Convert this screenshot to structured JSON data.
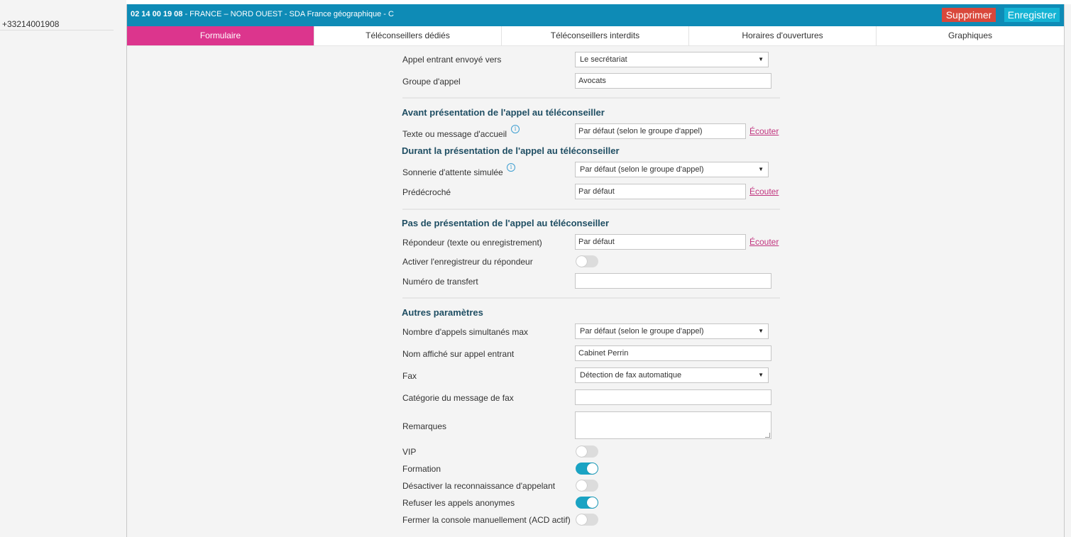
{
  "left_panel": {
    "phone": "+33214001908"
  },
  "header": {
    "number": "02 14 00 19 08",
    "description": " - FRANCE – NORD OUEST - SDA France géographique - C",
    "delete_label": "Supprimer",
    "save_label": "Enregistrer"
  },
  "tabs": [
    {
      "label": "Formulaire",
      "active": true
    },
    {
      "label": "Téléconseillers dédiés"
    },
    {
      "label": "Téléconseillers interdits"
    },
    {
      "label": "Horaires d'ouvertures"
    },
    {
      "label": "Graphiques"
    }
  ],
  "form": {
    "appel_entrant": {
      "label": "Appel entrant envoyé vers",
      "value": "Le secrétariat"
    },
    "groupe_appel": {
      "label": "Groupe d'appel",
      "value": "Avocats"
    },
    "section_avant": "Avant présentation de l'appel au téléconseiller",
    "texte_accueil": {
      "label": "Texte ou message d'accueil",
      "value": "Par défaut (selon le groupe d'appel)",
      "link": "Écouter"
    },
    "section_durant": "Durant la présentation de l'appel au téléconseiller",
    "sonnerie": {
      "label": "Sonnerie d'attente simulée",
      "value": "Par défaut (selon le groupe d'appel)"
    },
    "predecroche": {
      "label": "Prédécroché",
      "value": "Par défaut",
      "link": "Écouter"
    },
    "section_pas": "Pas de présentation de l'appel au téléconseiller",
    "repondeur": {
      "label": "Répondeur (texte ou enregistrement)",
      "value": "Par défaut",
      "link": "Écouter"
    },
    "enregistreur": {
      "label": "Activer l'enregistreur du répondeur",
      "on": false
    },
    "numero_transfert": {
      "label": "Numéro de transfert",
      "value": ""
    },
    "section_autres": "Autres paramètres",
    "nb_appels": {
      "label": "Nombre d'appels simultanés max",
      "value": "Par défaut (selon le groupe d'appel)"
    },
    "nom_affiche": {
      "label": "Nom affiché sur appel entrant",
      "value": "Cabinet Perrin"
    },
    "fax": {
      "label": "Fax",
      "value": "Détection de fax automatique"
    },
    "categorie_fax": {
      "label": "Catégorie du message de fax",
      "value": ""
    },
    "remarques": {
      "label": "Remarques",
      "value": ""
    },
    "vip": {
      "label": "VIP",
      "on": false
    },
    "formation": {
      "label": "Formation",
      "on": true
    },
    "desactiver_reco": {
      "label": "Désactiver la reconnaissance d'appelant",
      "on": false
    },
    "refuser_anonymes": {
      "label": "Refuser les appels anonymes",
      "on": true
    },
    "fermer_console": {
      "label": "Fermer la console manuellement (ACD actif)",
      "on": false
    }
  },
  "colors": {
    "header": "#0e8bb6",
    "active_tab": "#dc358d",
    "delete": "#d9483b",
    "save": "#14b3d4",
    "toggle_on": "#1aa3c3",
    "link": "#c1357f"
  },
  "icons": {
    "info": "info-icon",
    "dropdown": "chevron-down-icon"
  }
}
